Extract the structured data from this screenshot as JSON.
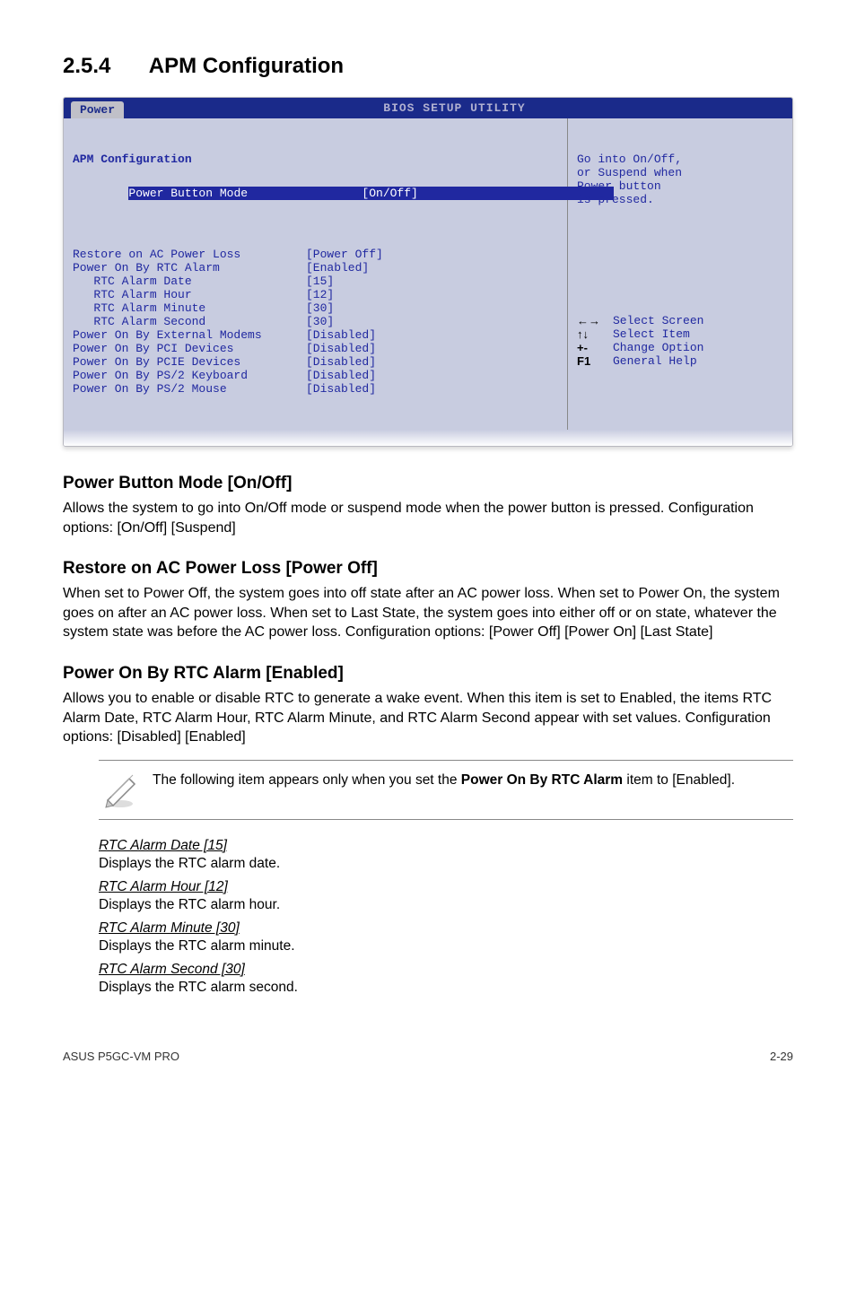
{
  "section": {
    "number": "2.5.4",
    "title": "APM Configuration"
  },
  "bios": {
    "header_title": "BIOS SETUP UTILITY",
    "tab": "Power",
    "panel_title": "APM Configuration",
    "selected": {
      "label": "Power Button Mode",
      "value": "[On/Off]"
    },
    "rows": [
      {
        "indent": false,
        "label": "Restore on AC Power Loss",
        "value": "[Power Off]"
      },
      {
        "indent": false,
        "label": "Power On By RTC Alarm",
        "value": "[Enabled]"
      },
      {
        "indent": true,
        "label": "RTC Alarm Date",
        "value": "[15]"
      },
      {
        "indent": true,
        "label": "RTC Alarm Hour",
        "value": "[12]"
      },
      {
        "indent": true,
        "label": "RTC Alarm Minute",
        "value": "[30]"
      },
      {
        "indent": true,
        "label": "RTC Alarm Second",
        "value": "[30]"
      },
      {
        "indent": false,
        "label": "Power On By External Modems",
        "value": "[Disabled]"
      },
      {
        "indent": false,
        "label": "Power On By PCI Devices",
        "value": "[Disabled]"
      },
      {
        "indent": false,
        "label": "Power On By PCIE Devices",
        "value": "[Disabled]"
      },
      {
        "indent": false,
        "label": "Power On By PS/2 Keyboard",
        "value": "[Disabled]"
      },
      {
        "indent": false,
        "label": "Power On By PS/2 Mouse",
        "value": "[Disabled]"
      }
    ],
    "help_top": "Go into On/Off,\nor Suspend when\nPower button\nis pressed.",
    "nav": [
      {
        "key": "←→",
        "desc": "Select Screen"
      },
      {
        "key": "↑↓",
        "desc": "Select Item"
      },
      {
        "key": "+-",
        "desc": "Change Option"
      },
      {
        "key": "F1",
        "desc": "General Help"
      }
    ]
  },
  "sub1": {
    "heading": "Power Button Mode [On/Off]",
    "text": "Allows the system to go into On/Off mode or suspend mode when the power button is pressed. Configuration options: [On/Off] [Suspend]"
  },
  "sub2": {
    "heading": "Restore on AC Power Loss [Power Off]",
    "text": "When set to Power Off, the system goes into off state after an AC power loss. When set to Power On, the system goes on after an AC power loss. When set to Last State, the system goes into either off or on state, whatever the system state was before the AC power loss. Configuration options: [Power Off] [Power On] [Last State]"
  },
  "sub3": {
    "heading": "Power On By RTC Alarm [Enabled]",
    "text": "Allows you to enable or disable RTC to generate a wake event. When this item is set to Enabled, the items RTC Alarm Date, RTC Alarm Hour, RTC Alarm Minute, and RTC Alarm Second appear with set values. Configuration options: [Disabled] [Enabled]"
  },
  "note": {
    "prefix": "The following item appears only when you set the ",
    "bold": "Power On By RTC Alarm",
    "suffix": " item to [Enabled]."
  },
  "opts": [
    {
      "name": "RTC Alarm Date [15]",
      "desc": "Displays the RTC alarm date."
    },
    {
      "name": "RTC Alarm Hour [12]",
      "desc": "Displays the RTC alarm hour."
    },
    {
      "name": "RTC Alarm Minute [30]",
      "desc": "Displays the RTC alarm minute."
    },
    {
      "name": "RTC Alarm Second [30]",
      "desc": "Displays the RTC alarm second."
    }
  ],
  "footer": {
    "left": "ASUS P5GC-VM PRO",
    "right": "2-29"
  }
}
